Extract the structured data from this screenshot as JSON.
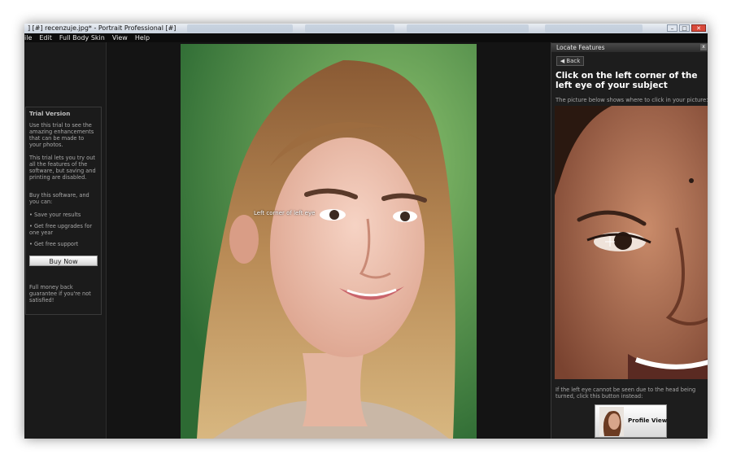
{
  "window": {
    "title": "] [#] recenzuje.jpg* - Portrait Professional [#]",
    "controls": {
      "minimize": "–",
      "maximize": "□",
      "close": "✕"
    }
  },
  "menu": [
    "ile",
    "Edit",
    "Full Body Skin",
    "View",
    "Help"
  ],
  "trial": {
    "title": "Trial Version",
    "p1": "Use this trial to see the amazing enhancements that can be made to your photos.",
    "p2": "This trial lets you try out all the features of the software, but saving and printing are disabled.",
    "p3": "Buy this software, and you can:",
    "bullets": [
      "• Save your results",
      "• Get free upgrades for one year",
      "• Get free support"
    ],
    "buy_label": "Buy Now",
    "guarantee": "Full money back guarantee if you're not satisfied!"
  },
  "canvas": {
    "eye_label": "Left corner of left eye"
  },
  "panel": {
    "header": "Locate Features",
    "close_glyph": "x",
    "back_label": "Back",
    "instruction": "Click on the left corner of the left eye of your subject",
    "sub_text": "The picture below shows where to click in your picture:",
    "bottom_text": "If the left eye cannot be seen due to the head being turned, click this button instead:",
    "profile_label": "Profile View"
  },
  "icons": {
    "back": "back-arrow-icon",
    "crosshair": "crosshair-icon"
  }
}
